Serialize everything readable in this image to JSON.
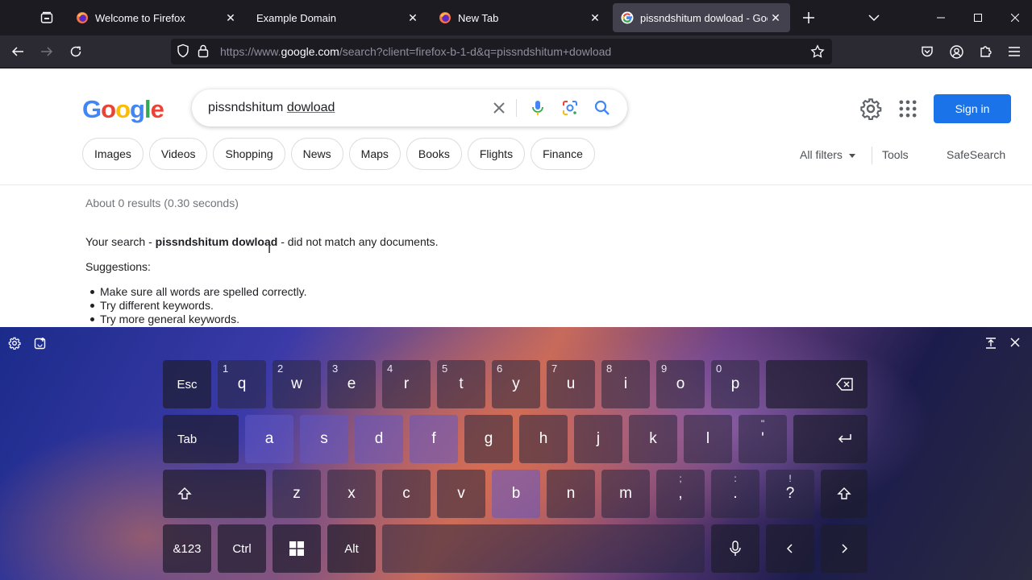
{
  "browser": {
    "tabs": [
      {
        "title": "Welcome to Firefox",
        "icon": "firefox-icon",
        "active": false
      },
      {
        "title": "Example Domain",
        "icon": "none",
        "active": false
      },
      {
        "title": "New Tab",
        "icon": "firefox-icon",
        "active": false
      },
      {
        "title": "pissndshitum dowload - Google",
        "icon": "google-g-icon",
        "active": true
      }
    ],
    "url_prefix": "https://www.",
    "url_domain": "google.com",
    "url_path": "/search?client=firefox-b-1-d&q=pissndshitum+dowload"
  },
  "google": {
    "logo_letters": [
      "G",
      "o",
      "o",
      "g",
      "l",
      "e"
    ],
    "logo_colors": [
      "#4285f4",
      "#ea4335",
      "#fbbc05",
      "#4285f4",
      "#34a853",
      "#ea4335"
    ],
    "query_part1": "pissndshitum ",
    "query_part2": "dowload",
    "signin_label": "Sign in",
    "chips": [
      "Images",
      "Videos",
      "Shopping",
      "News",
      "Maps",
      "Books",
      "Flights",
      "Finance"
    ],
    "all_filters_label": "All filters",
    "tools_label": "Tools",
    "safesearch_label": "SafeSearch",
    "result_stats": "About 0 results (0.30 seconds)",
    "no_match_prefix": "Your search - ",
    "no_match_query": "pissndshitum dowload",
    "no_match_suffix": " - did not match any documents.",
    "suggestions_label": "Suggestions:",
    "suggestions": [
      "Make sure all words are spelled correctly.",
      "Try different keywords.",
      "Try more general keywords."
    ],
    "brand_blue": "#1a73e8"
  },
  "keyboard": {
    "row1": [
      {
        "label": "Esc",
        "hint": ""
      },
      {
        "label": "q",
        "hint": "1"
      },
      {
        "label": "w",
        "hint": "2"
      },
      {
        "label": "e",
        "hint": "3"
      },
      {
        "label": "r",
        "hint": "4"
      },
      {
        "label": "t",
        "hint": "5"
      },
      {
        "label": "y",
        "hint": "6"
      },
      {
        "label": "u",
        "hint": "7"
      },
      {
        "label": "i",
        "hint": "8"
      },
      {
        "label": "o",
        "hint": "9"
      },
      {
        "label": "p",
        "hint": "0"
      }
    ],
    "row2": [
      {
        "label": "Tab",
        "top": ""
      },
      {
        "label": "a",
        "top": ""
      },
      {
        "label": "s",
        "top": ""
      },
      {
        "label": "d",
        "top": ""
      },
      {
        "label": "f",
        "top": ""
      },
      {
        "label": "g",
        "top": ""
      },
      {
        "label": "h",
        "top": ""
      },
      {
        "label": "j",
        "top": ""
      },
      {
        "label": "k",
        "top": ""
      },
      {
        "label": "l",
        "top": ""
      },
      {
        "label": "'",
        "top": "\""
      }
    ],
    "row3": [
      {
        "label": "z",
        "top": ""
      },
      {
        "label": "x",
        "top": ""
      },
      {
        "label": "c",
        "top": ""
      },
      {
        "label": "v",
        "top": ""
      },
      {
        "label": "b",
        "top": ""
      },
      {
        "label": "n",
        "top": ""
      },
      {
        "label": "m",
        "top": ""
      },
      {
        "label": ",",
        "top": ";"
      },
      {
        "label": ".",
        "top": ":"
      },
      {
        "label": "?",
        "top": "!"
      }
    ],
    "row4_left": [
      "&123",
      "Ctrl"
    ],
    "alt_label": "Alt"
  }
}
